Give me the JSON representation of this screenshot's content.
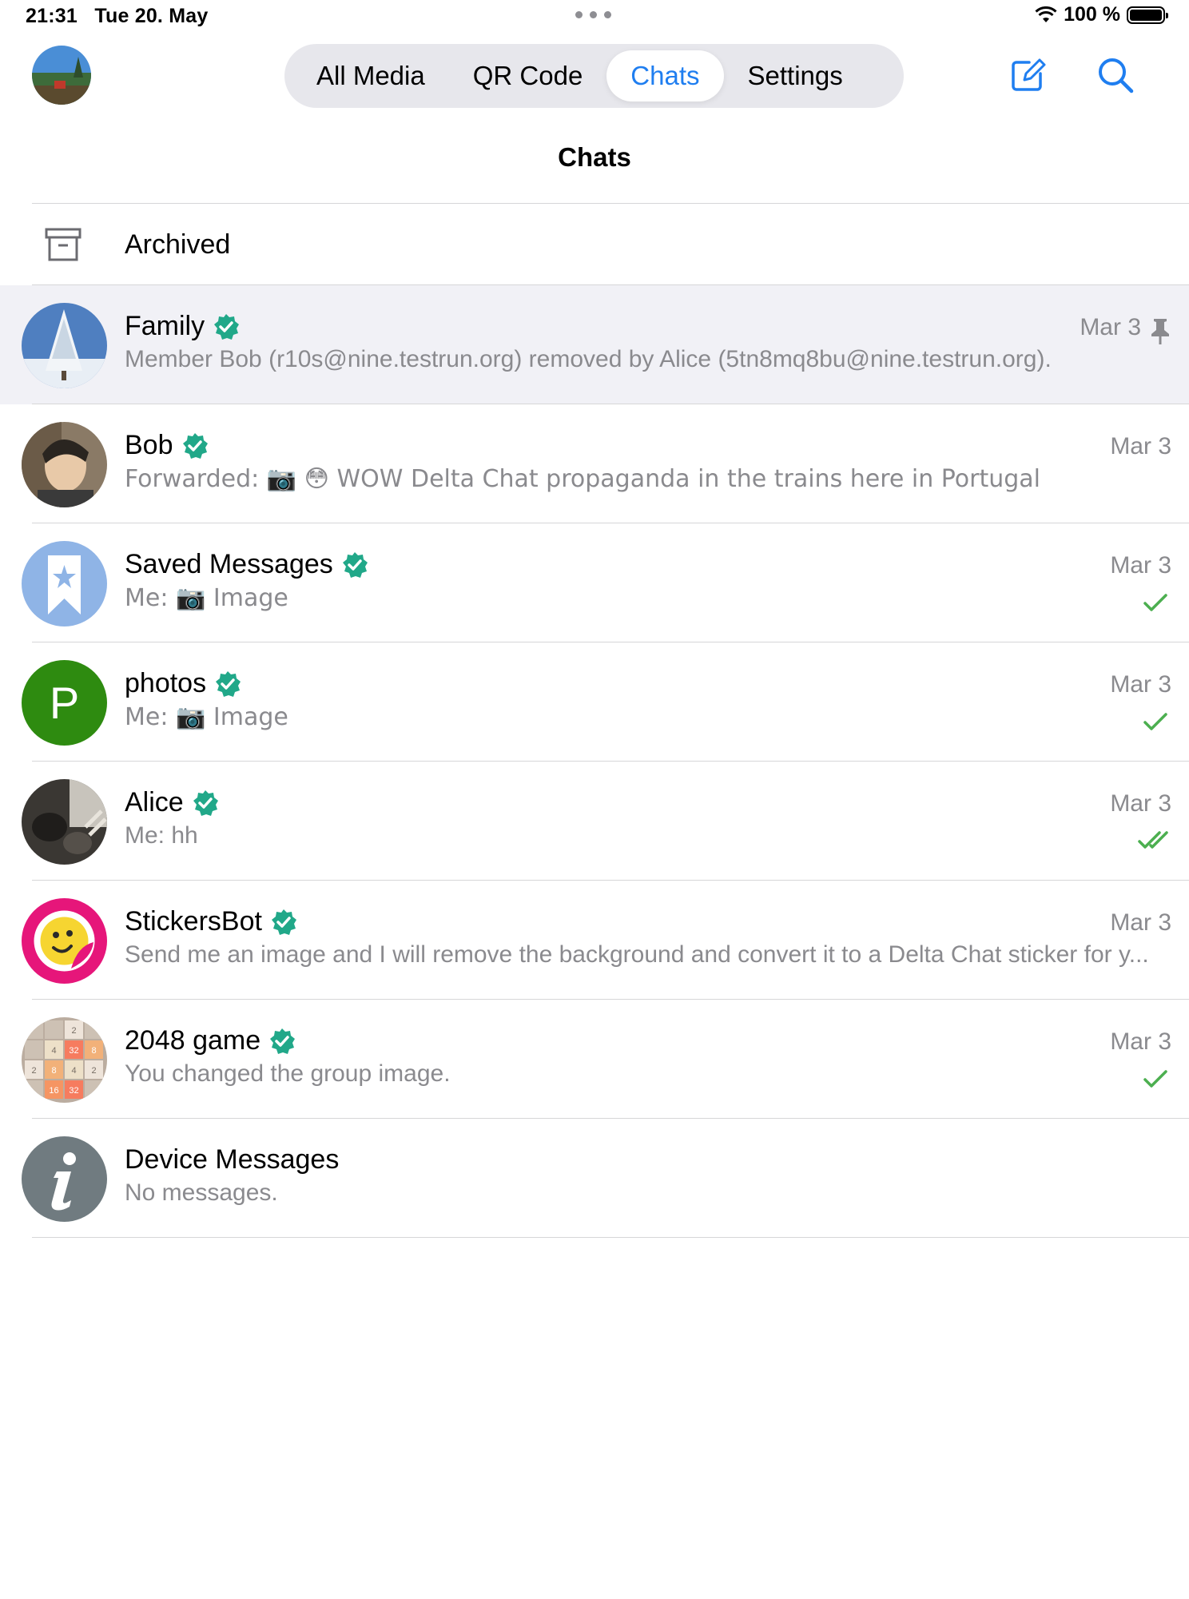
{
  "status_bar": {
    "time": "21:31",
    "date": "Tue 20. May",
    "battery": "100 %"
  },
  "tabs": [
    {
      "label": "All Media",
      "active": false
    },
    {
      "label": "QR Code",
      "active": false
    },
    {
      "label": "Chats",
      "active": true
    },
    {
      "label": "Settings",
      "active": false
    }
  ],
  "page_title": "Chats",
  "archived_label": "Archived",
  "accent_color": "#1f7ef0",
  "verified_color": "#21a889",
  "chats": [
    {
      "name": "Family",
      "preview": "Member Bob (r10s@nine.testrun.org) removed by Alice (5tn8mq8bu@nine.testrun.org).",
      "date": "Mar 3",
      "pinned": true,
      "verified": true,
      "status": "none"
    },
    {
      "name": "Bob",
      "preview": "Forwarded: 📷 😳 WOW Delta Chat propaganda in the trains here in Portugal",
      "date": "Mar 3",
      "verified": true,
      "status": "none"
    },
    {
      "name": "Saved Messages",
      "preview": "Me: 📷 Image",
      "date": "Mar 3",
      "verified": true,
      "status": "delivered"
    },
    {
      "name": "photos",
      "preview": "Me: 📷 Image",
      "date": "Mar 3",
      "verified": true,
      "status": "delivered",
      "avatar_letter": "P"
    },
    {
      "name": "Alice",
      "preview": "Me: hh",
      "date": "Mar 3",
      "verified": true,
      "status": "read"
    },
    {
      "name": "StickersBot",
      "preview": "Send me an image and I will remove the background and convert it to a Delta Chat sticker for y...",
      "date": "Mar 3",
      "verified": true,
      "status": "none"
    },
    {
      "name": "2048 game",
      "preview": "You changed the group image.",
      "date": "Mar 3",
      "verified": true,
      "status": "delivered"
    },
    {
      "name": "Device Messages",
      "preview": "No messages.",
      "date": "",
      "verified": false,
      "status": "none"
    }
  ]
}
